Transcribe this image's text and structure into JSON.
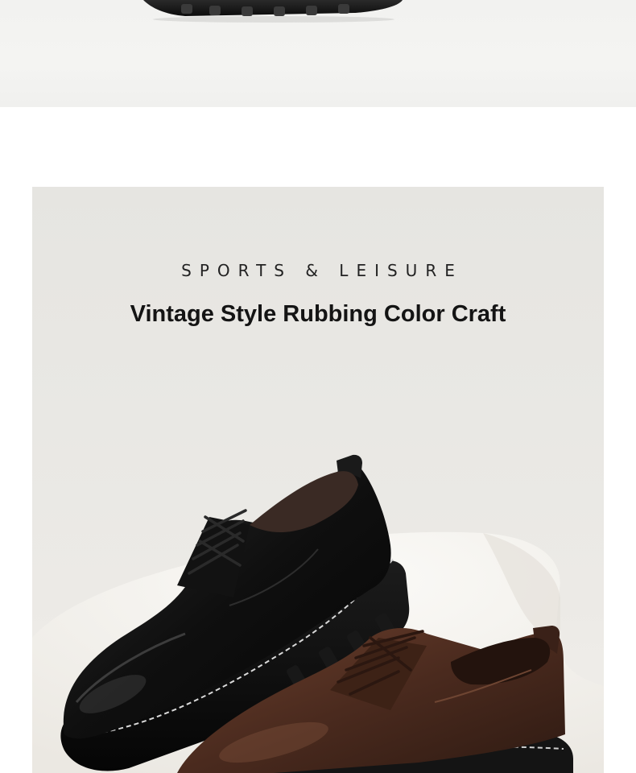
{
  "top_section": {
    "image_alt": "shoe-sole-closeup-photo"
  },
  "banner": {
    "subtitle": "SPORTS & LEISURE",
    "headline": "Vintage Style Rubbing Color Craft",
    "image_alt": "black-and-brown-leather-derby-shoes-photo"
  },
  "colors": {
    "page_background": "#ffffff",
    "banner_background": "#e8e7e3",
    "text_dark": "#141414",
    "shoe_black": "#111111",
    "shoe_brown": "#4a2c20"
  }
}
